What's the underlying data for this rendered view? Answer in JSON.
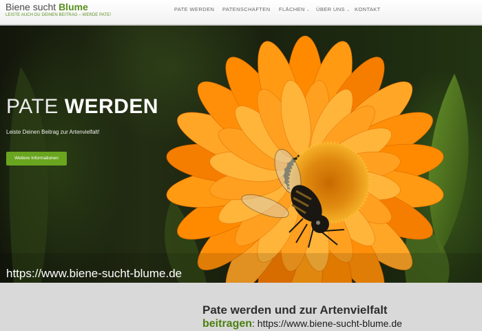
{
  "header": {
    "brand_main": "Biene sucht",
    "brand_accent": "Blume",
    "tagline": "LEISTE AUCH DU DEINEN BEITRAG – WERDE PATE!",
    "nav": [
      {
        "label": "PATE WERDEN",
        "dropdown": false
      },
      {
        "label": "PATENSCHAFTEN",
        "dropdown": false
      },
      {
        "label": "FLÄCHEN",
        "dropdown": true
      },
      {
        "label": "ÜBER UNS",
        "dropdown": true
      },
      {
        "label": "KONTAKT",
        "dropdown": false
      }
    ],
    "caret": "⌄"
  },
  "hero": {
    "title_light": "PATE ",
    "title_bold": "WERDEN",
    "subtitle": "Leiste Deinen Beitrag zur Artenvielfalt!",
    "button_label": "Weitere Informationen",
    "url_overlay": "https://www.biene-sucht-blume.de"
  },
  "caption": {
    "line1": "Pate werden und zur Artenvielfalt",
    "line2_green": "beitragen",
    "line2_rest": ":  https://www.biene-sucht-blume.de"
  },
  "colors": {
    "accent_green": "#6aa51f",
    "brand_green": "#5a8f1f",
    "petal_orange": "#ff8a00"
  }
}
